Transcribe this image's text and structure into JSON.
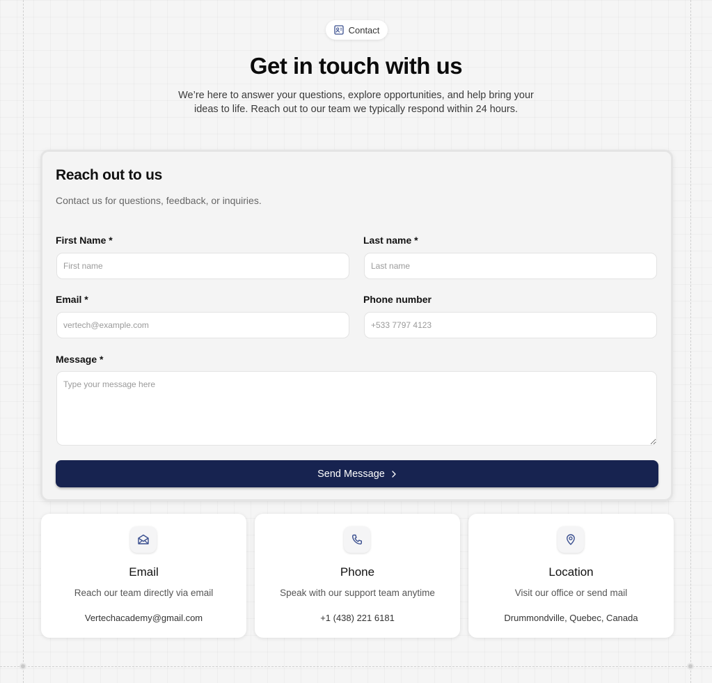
{
  "hero": {
    "badge": "Contact",
    "title": "Get in touch with us",
    "subtitle": "We’re here to answer your questions, explore opportunities, and help bring your ideas to life. Reach out to our team we typically respond within 24 hours."
  },
  "form": {
    "title": "Reach out to us",
    "subtitle": "Contact us for questions, feedback, or inquiries.",
    "first_name": {
      "label": "First Name *",
      "placeholder": "First name",
      "value": ""
    },
    "last_name": {
      "label": "Last name *",
      "placeholder": "Last name",
      "value": ""
    },
    "email": {
      "label": "Email *",
      "placeholder": "vertech@example.com",
      "value": ""
    },
    "phone": {
      "label": "Phone number",
      "placeholder": "+533 7797 4123",
      "value": ""
    },
    "message": {
      "label": "Message *",
      "placeholder": "Type your message here",
      "value": ""
    },
    "submit_label": "Send Message"
  },
  "contact_cards": [
    {
      "icon": "mail-icon",
      "title": "Email",
      "description": "Reach our team directly via email",
      "value": "Vertechacademy@gmail.com"
    },
    {
      "icon": "phone-icon",
      "title": "Phone",
      "description": "Speak with our support team anytime",
      "value": "+1 (438) 221 6181"
    },
    {
      "icon": "location-pin-icon",
      "title": "Location",
      "description": "Visit our office or send mail",
      "value": "Drummondville, Quebec, Canada"
    }
  ],
  "colors": {
    "primary": "#172350",
    "icon_accent": "#3a4f8f",
    "background": "#f5f5f5"
  }
}
